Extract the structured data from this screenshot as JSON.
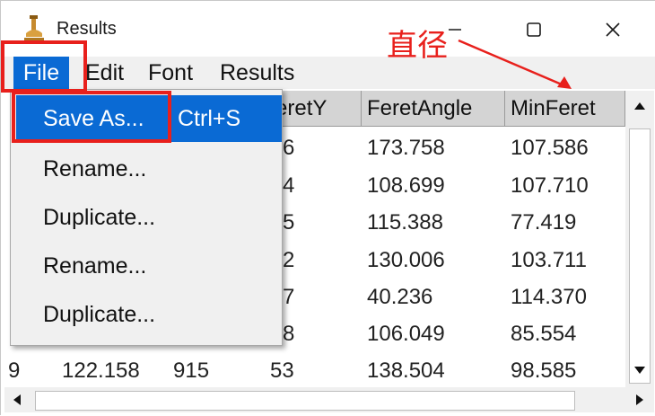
{
  "window": {
    "title": "Results"
  },
  "menubar": {
    "file": "File",
    "edit": "Edit",
    "font": "Font",
    "results": "Results"
  },
  "table": {
    "headers": {
      "c3": "eretY",
      "c4": "FeretAngle",
      "c5": "MinFeret"
    },
    "rows": [
      {
        "c3": "6",
        "c4": "173.758",
        "c5": "107.586"
      },
      {
        "c3": "4",
        "c4": "108.699",
        "c5": "107.710"
      },
      {
        "c3": "5",
        "c4": "115.388",
        "c5": "77.419"
      },
      {
        "c3": "2",
        "c4": "130.006",
        "c5": "103.711"
      },
      {
        "c3": "7",
        "c4": "40.236",
        "c5": "114.370"
      },
      {
        "c3": "8",
        "c4": "106.049",
        "c5": "85.554"
      }
    ],
    "last_row": {
      "c0": "9",
      "c1": "122.158",
      "c2": "915",
      "c3": "53",
      "c4": "138.504",
      "c5": "98.585"
    }
  },
  "file_menu": {
    "items": [
      {
        "label": "Save As...",
        "shortcut": "Ctrl+S"
      },
      {
        "label": "Rename..."
      },
      {
        "label": "Duplicate..."
      },
      {
        "label": "Rename..."
      },
      {
        "label": "Duplicate..."
      }
    ]
  },
  "annotation": {
    "text": "直径",
    "color": "#e8201c"
  },
  "colors": {
    "highlight": "#0a6ad4",
    "header_bg": "#d4d4d4",
    "menubar_bg": "#f0f0f0"
  }
}
